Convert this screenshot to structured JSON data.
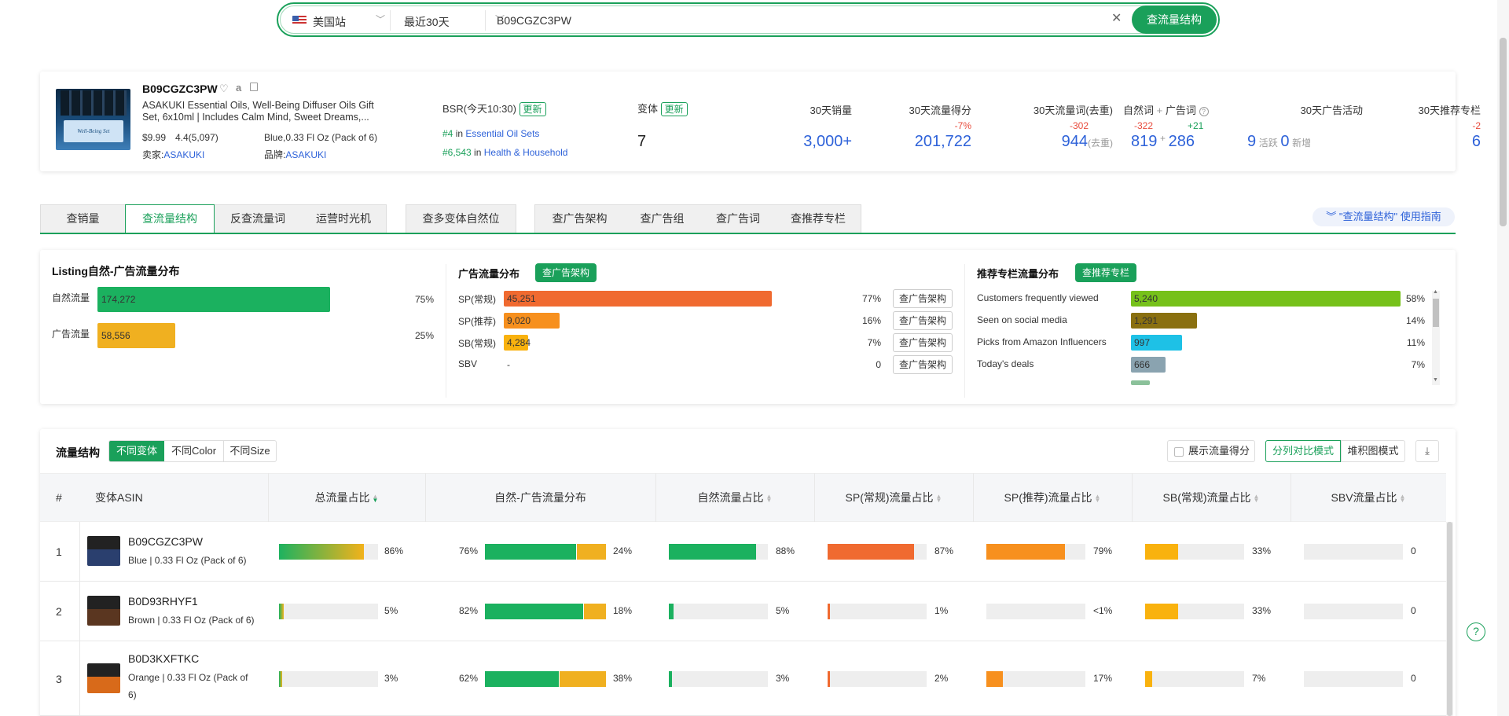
{
  "search": {
    "site": "美国站",
    "range": "最近30天",
    "query": "B09CGZC3PW",
    "button": "查流量结构"
  },
  "product": {
    "asin": "B09CGZC3PW",
    "title_line1": "ASAKUKI Essential Oils, Well-Being Diffuser Oils Gift",
    "title_line2": "Set, 6x10ml | Includes Calm Mind, Sweet Dreams,...",
    "price": "$9.99",
    "rating": "4.4(5,097)",
    "variant": "Blue,0.33 Fl Oz (Pack of 6)",
    "seller_label": "卖家:",
    "seller": "ASAKUKI",
    "brand_label": "品牌:",
    "brand": "ASAKUKI",
    "box_label": "Well-Being Set"
  },
  "bsr": {
    "label": "BSR(今天10:30)",
    "update": "更新",
    "rank1": "#4",
    "in1": "in",
    "cat1": "Essential Oil Sets",
    "rank2": "#6,543",
    "in2": "in",
    "cat2": "Health & Household"
  },
  "stats": {
    "variants": {
      "label": "变体",
      "update": "更新",
      "value": "7"
    },
    "sales": {
      "label": "30天销量",
      "value": "3,000+"
    },
    "score": {
      "label": "30天流量得分",
      "delta": "-7%",
      "value": "201,722"
    },
    "keywords": {
      "label": "30天流量词(去重)",
      "delta": "-302",
      "value": "944",
      "suffix": "(去重)"
    },
    "nat_ad": {
      "label_nat": "自然词",
      "plus": "+",
      "label_ad": "广告词",
      "delta_nat": "-322",
      "delta_ad": "+21",
      "nat": "819",
      "ad": "286"
    },
    "ad_activity": {
      "label": "30天广告活动",
      "active": "9",
      "active_label": "活跃",
      "new": "0",
      "new_label": "新增"
    },
    "recommend": {
      "label": "30天推荐专栏",
      "delta": "-2",
      "value": "6"
    }
  },
  "tabs": {
    "g1": [
      "查销量",
      "查流量结构",
      "反查流量词",
      "运营时光机"
    ],
    "g2": [
      "查多变体自然位"
    ],
    "g3": [
      "查广告架构",
      "查广告组",
      "查广告词",
      "查推荐专栏"
    ],
    "guide": "\"查流量结构\" 使用指南"
  },
  "listing": {
    "title": "Listing自然-广告流量分布",
    "rows": [
      {
        "label": "自然流量",
        "value": "174,272",
        "pct": "75%",
        "frac": 0.75,
        "color": "#1bb15f"
      },
      {
        "label": "广告流量",
        "value": "58,556",
        "pct": "25%",
        "frac": 0.25,
        "color": "#f0b020"
      }
    ]
  },
  "ad_dist": {
    "title": "广告流量分布",
    "button": "查广告架构",
    "rows": [
      {
        "label": "SP(常规)",
        "value": "45,251",
        "pct": "77%",
        "frac": 0.77,
        "color": "#f06a30",
        "btn": "查广告架构"
      },
      {
        "label": "SP(推荐)",
        "value": "9,020",
        "pct": "16%",
        "frac": 0.16,
        "color": "#f7901e",
        "btn": "查广告架构"
      },
      {
        "label": "SB(常规)",
        "value": "4,284",
        "pct": "7%",
        "frac": 0.07,
        "color": "#f9b20e",
        "btn": "查广告架构"
      },
      {
        "label": "SBV",
        "value": "-",
        "pct": "0",
        "frac": 0,
        "color": "#f9b20e",
        "btn": "查广告架构"
      }
    ]
  },
  "rec_dist": {
    "title": "推荐专栏流量分布",
    "button": "查推荐专栏",
    "rows": [
      {
        "label": "Customers frequently viewed",
        "value": "5,240",
        "pct": "58%",
        "frac": 1.0,
        "color": "#76c11a"
      },
      {
        "label": "Seen on social media",
        "value": "1,291",
        "pct": "14%",
        "frac": 0.246,
        "color": "#8a7010"
      },
      {
        "label": "Picks from Amazon Influencers",
        "value": "997",
        "pct": "11%",
        "frac": 0.19,
        "color": "#1ec1e6"
      },
      {
        "label": "Today's deals",
        "value": "666",
        "pct": "7%",
        "frac": 0.127,
        "color": "#8aa3b0"
      }
    ]
  },
  "structure": {
    "title": "流量结构",
    "seg": [
      "不同变体",
      "不同Color",
      "不同Size"
    ],
    "show_score": "展示流量得分",
    "mode1": "分列对比模式",
    "mode2": "堆积图模式"
  },
  "table": {
    "headers": [
      "#",
      "变体ASIN",
      "总流量占比",
      "自然-广告流量分布",
      "自然流量占比",
      "SP(常规)流量占比",
      "SP(推荐)流量占比",
      "SB(常规)流量占比",
      "SBV流量占比"
    ],
    "rows": [
      {
        "num": "1",
        "asin": "B09CGZC3PW",
        "sub1": "Blue | 0.33 Fl Oz (Pack of 6)",
        "sub2": "",
        "total": "86%",
        "total_f": 0.86,
        "nat_pct": "76%",
        "ad_pct": "24%",
        "nat_f": 0.76,
        "natural": "88%",
        "natural_f": 0.88,
        "sp": "87%",
        "sp_f": 0.87,
        "spr": "79%",
        "spr_f": 0.79,
        "sb": "33%",
        "sb_f": 0.33,
        "sbv": "0",
        "thumb": "#2a3f6e"
      },
      {
        "num": "2",
        "asin": "B0D93RHYF1",
        "sub1": "Brown | 0.33 Fl Oz (Pack of 6)",
        "sub2": "",
        "total": "5%",
        "total_f": 0.05,
        "nat_pct": "82%",
        "ad_pct": "18%",
        "nat_f": 0.82,
        "natural": "5%",
        "natural_f": 0.05,
        "sp": "1%",
        "sp_f": 0.01,
        "spr": "<1%",
        "spr_f": 0,
        "sb": "33%",
        "sb_f": 0.33,
        "sbv": "0",
        "thumb": "#5a3620"
      },
      {
        "num": "3",
        "asin": "B0D3KXFTKC",
        "sub1": "Orange | 0.33 Fl Oz (Pack of",
        "sub2": "6)",
        "total": "3%",
        "total_f": 0.03,
        "nat_pct": "62%",
        "ad_pct": "38%",
        "nat_f": 0.62,
        "natural": "3%",
        "natural_f": 0.03,
        "sp": "2%",
        "sp_f": 0.02,
        "spr": "17%",
        "spr_f": 0.17,
        "sb": "7%",
        "sb_f": 0.07,
        "sbv": "0",
        "thumb": "#d86a1a"
      }
    ]
  }
}
